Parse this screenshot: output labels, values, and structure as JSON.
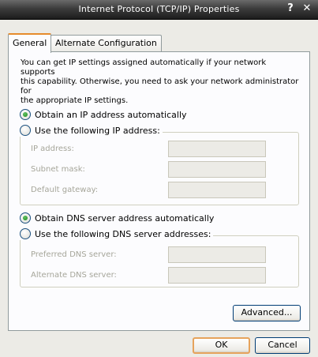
{
  "window": {
    "title": "Internet Protocol (TCP/IP) Properties",
    "help_glyph": "?",
    "close_glyph": "✕"
  },
  "tabs": [
    {
      "label": "General",
      "active": true
    },
    {
      "label": "Alternate Configuration",
      "active": false
    }
  ],
  "intro": {
    "line1": "You can get IP settings assigned automatically if your network supports",
    "line2": "this capability. Otherwise, you need to ask your network administrator for",
    "line3": "the appropriate IP settings."
  },
  "ip": {
    "auto_label": "Obtain an IP address automatically",
    "manual_label": "Use the following IP address:",
    "auto_selected": true,
    "fields": [
      {
        "label": "IP address:",
        "value": ""
      },
      {
        "label": "Subnet mask:",
        "value": ""
      },
      {
        "label": "Default gateway:",
        "value": ""
      }
    ]
  },
  "dns": {
    "auto_label": "Obtain DNS server address automatically",
    "manual_label": "Use the following DNS server addresses:",
    "auto_selected": true,
    "fields": [
      {
        "label": "Preferred DNS server:",
        "value": ""
      },
      {
        "label": "Alternate DNS server:",
        "value": ""
      }
    ]
  },
  "buttons": {
    "advanced": "Advanced...",
    "ok": "OK",
    "cancel": "Cancel"
  },
  "colors": {
    "title_bar": "#3c3c3c",
    "active_tab_accent": "#e68b2c",
    "disabled_text": "#a6a69a"
  }
}
